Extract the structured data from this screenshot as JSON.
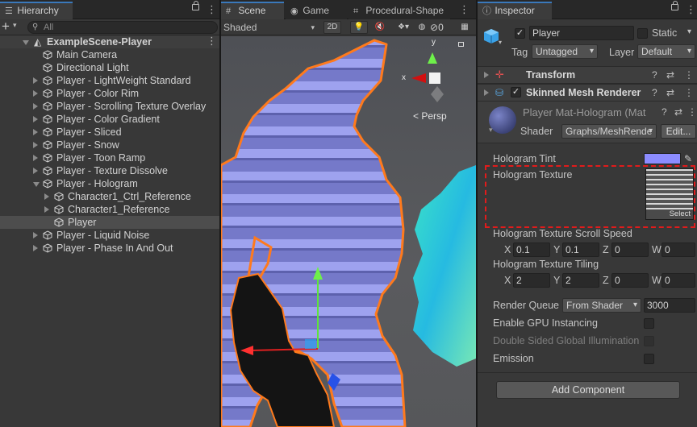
{
  "hierarchy": {
    "tab_label": "Hierarchy",
    "search_placeholder": "All",
    "scene_name": "ExampleScene-Player",
    "items": [
      {
        "label": "Main Camera",
        "depth": 1,
        "arrow": "none",
        "selected": false
      },
      {
        "label": "Directional Light",
        "depth": 1,
        "arrow": "none",
        "selected": false
      },
      {
        "label": "Player - LightWeight Standard",
        "depth": 1,
        "arrow": "right",
        "selected": false
      },
      {
        "label": "Player - Color Rim",
        "depth": 1,
        "arrow": "right",
        "selected": false
      },
      {
        "label": "Player - Scrolling Texture Overlay",
        "depth": 1,
        "arrow": "right",
        "selected": false
      },
      {
        "label": "Player - Color Gradient",
        "depth": 1,
        "arrow": "right",
        "selected": false
      },
      {
        "label": "Player - Sliced",
        "depth": 1,
        "arrow": "right",
        "selected": false
      },
      {
        "label": "Player - Snow",
        "depth": 1,
        "arrow": "right",
        "selected": false
      },
      {
        "label": "Player - Toon Ramp",
        "depth": 1,
        "arrow": "right",
        "selected": false
      },
      {
        "label": "Player - Texture Dissolve",
        "depth": 1,
        "arrow": "right",
        "selected": false
      },
      {
        "label": "Player - Hologram",
        "depth": 1,
        "arrow": "down",
        "selected": false
      },
      {
        "label": "Character1_Ctrl_Reference",
        "depth": 2,
        "arrow": "right",
        "selected": false
      },
      {
        "label": "Character1_Reference",
        "depth": 2,
        "arrow": "right",
        "selected": false
      },
      {
        "label": "Player",
        "depth": 2,
        "arrow": "none",
        "selected": true
      },
      {
        "label": "Player - Liquid Noise",
        "depth": 1,
        "arrow": "right",
        "selected": false
      },
      {
        "label": "Player - Phase In And Out",
        "depth": 1,
        "arrow": "right",
        "selected": false
      }
    ]
  },
  "scene": {
    "tabs": [
      "Scene",
      "Game",
      "Procedural-Shape"
    ],
    "shading_mode": "Shaded",
    "mode_2d": "2D",
    "gizmo_count": "0",
    "persp_label": "Persp",
    "gizmo_axis_x": "x",
    "gizmo_axis_y": "y"
  },
  "inspector": {
    "tab_label": "Inspector",
    "object_name": "Player",
    "static_label": "Static",
    "tag_label": "Tag",
    "tag_value": "Untagged",
    "layer_label": "Layer",
    "layer_value": "Default",
    "transform_label": "Transform",
    "renderer_label": "Skinned Mesh Renderer",
    "material_name": "Player Mat-Hologram (Mat",
    "shader_label": "Shader",
    "shader_value": "Graphs/MeshRende",
    "edit_label": "Edit...",
    "tint_label": "Hologram Tint",
    "tint_color": "#8c8cff",
    "texture_label": "Hologram Texture",
    "select_label": "Select",
    "scroll_label": "Hologram Texture Scroll Speed",
    "scroll": {
      "x": "0.1",
      "y": "0.1",
      "z": "0",
      "w": "0"
    },
    "tiling_label": "Hologram Texture Tiling",
    "tiling": {
      "x": "2",
      "y": "2",
      "z": "0",
      "w": "0"
    },
    "axis": {
      "x": "X",
      "y": "Y",
      "z": "Z",
      "w": "W"
    },
    "render_queue_label": "Render Queue",
    "render_queue_mode": "From Shader",
    "render_queue_value": "3000",
    "gpu_instancing_label": "Enable GPU Instancing",
    "double_sided_label": "Double Sided Global Illumination",
    "emission_label": "Emission",
    "add_component_label": "Add Component"
  }
}
